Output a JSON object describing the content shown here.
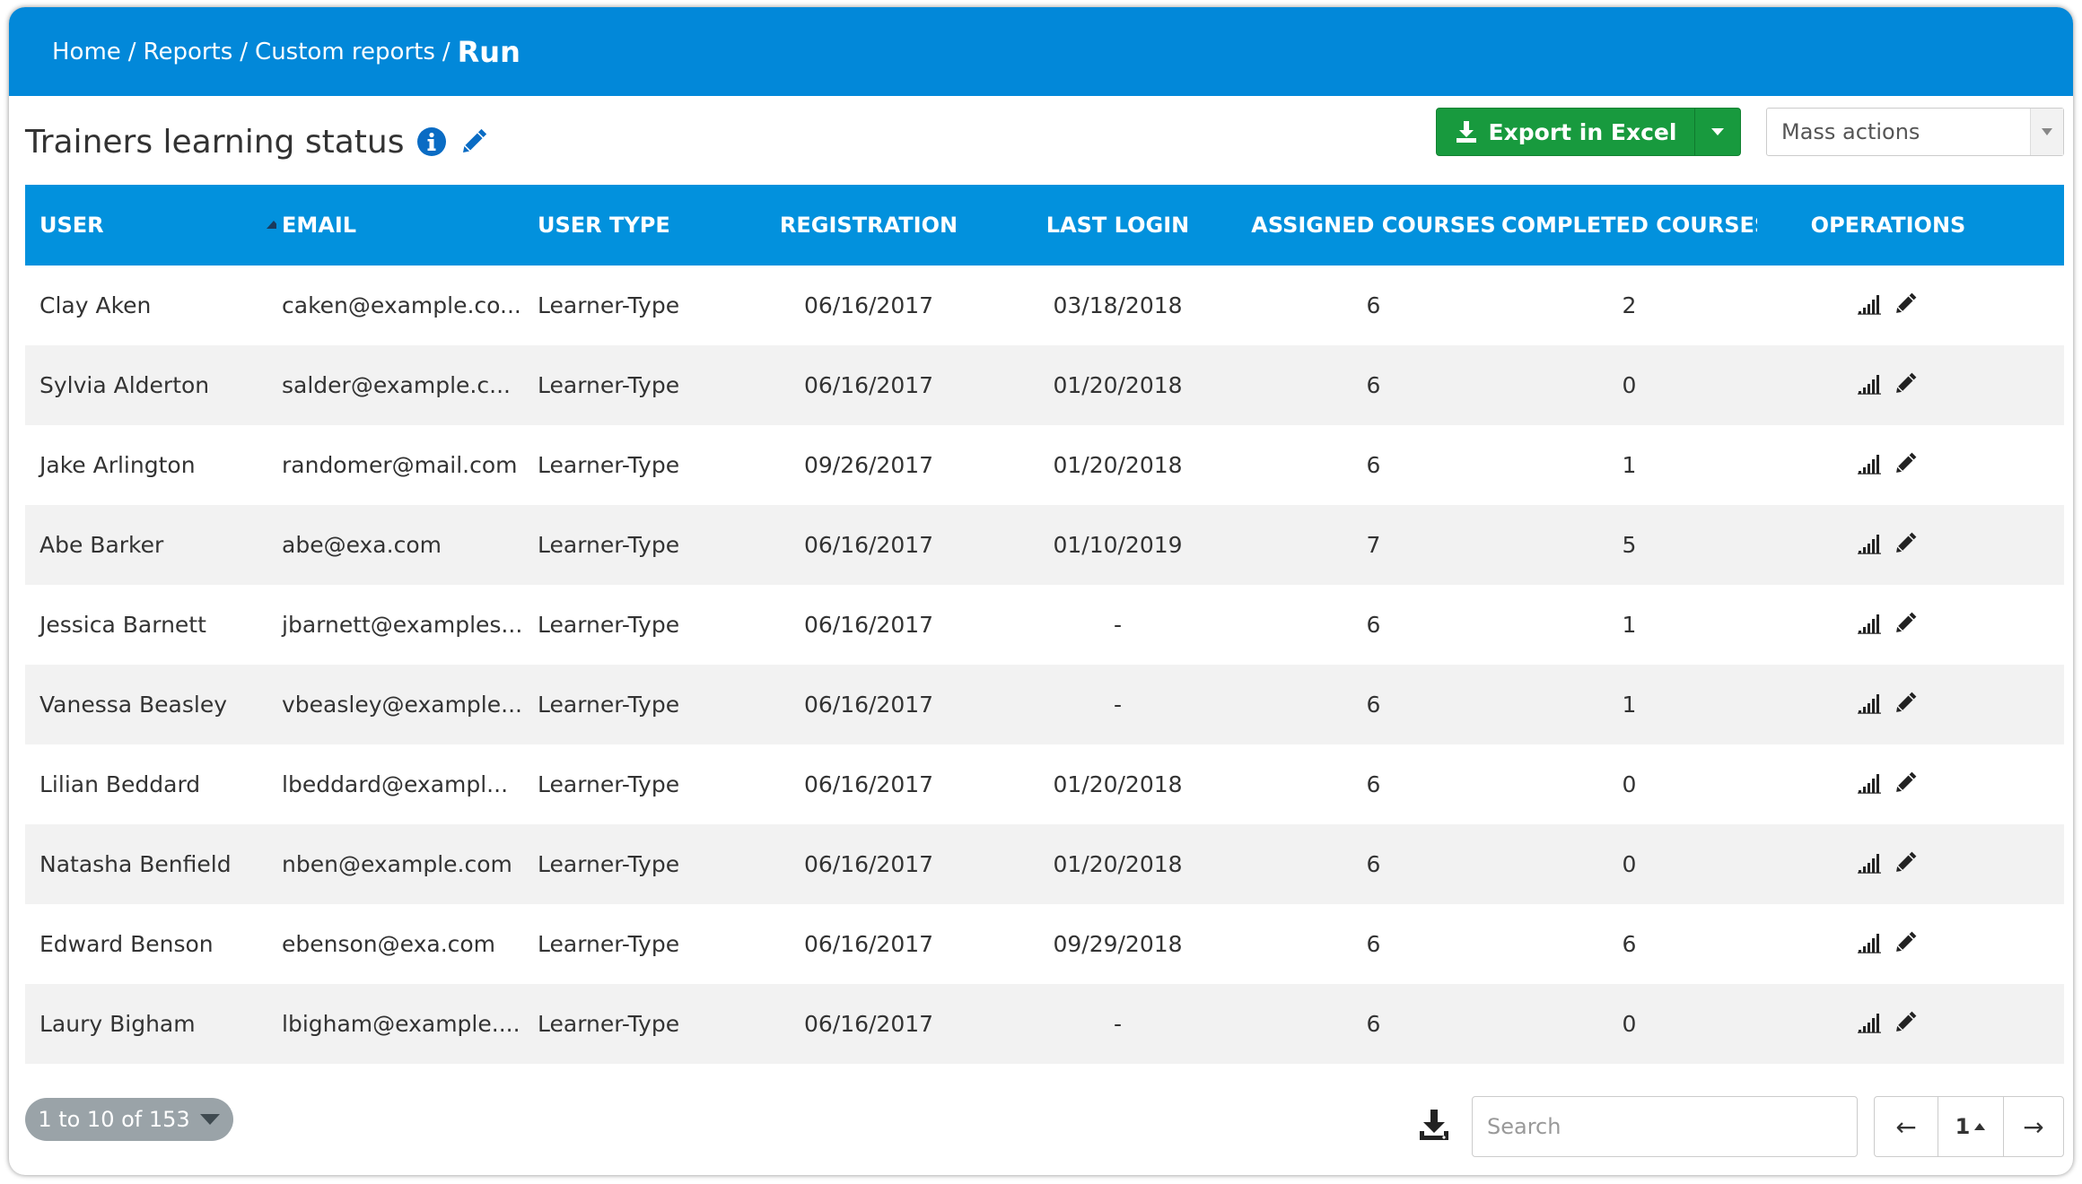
{
  "breadcrumb": {
    "items": [
      "Home",
      "Reports",
      "Custom reports"
    ],
    "current": "Run",
    "separator": "/"
  },
  "report": {
    "title": "Trainers learning status"
  },
  "toolbar": {
    "export_label": "Export in Excel",
    "mass_actions_label": "Mass actions"
  },
  "table": {
    "columns": [
      "USER",
      "EMAIL",
      "USER TYPE",
      "REGISTRATION",
      "LAST LOGIN",
      "ASSIGNED COURSES",
      "COMPLETED COURSES",
      "OPERATIONS"
    ],
    "sorted_column": "USER",
    "sort_direction": "ascending",
    "rows": [
      {
        "user": "Clay Aken",
        "email": "caken@example.co...",
        "type": "Learner-Type",
        "registration": "06/16/2017",
        "last_login": "03/18/2018",
        "assigned": "6",
        "completed": "2"
      },
      {
        "user": "Sylvia Alderton",
        "email": "salder@example.c...",
        "type": "Learner-Type",
        "registration": "06/16/2017",
        "last_login": "01/20/2018",
        "assigned": "6",
        "completed": "0"
      },
      {
        "user": "Jake Arlington",
        "email": "randomer@mail.com",
        "type": "Learner-Type",
        "registration": "09/26/2017",
        "last_login": "01/20/2018",
        "assigned": "6",
        "completed": "1"
      },
      {
        "user": "Abe Barker",
        "email": "abe@exa.com",
        "type": "Learner-Type",
        "registration": "06/16/2017",
        "last_login": "01/10/2019",
        "assigned": "7",
        "completed": "5"
      },
      {
        "user": "Jessica Barnett",
        "email": "jbarnett@examples...",
        "type": "Learner-Type",
        "registration": "06/16/2017",
        "last_login": "-",
        "assigned": "6",
        "completed": "1"
      },
      {
        "user": "Vanessa Beasley",
        "email": "vbeasley@example...",
        "type": "Learner-Type",
        "registration": "06/16/2017",
        "last_login": "-",
        "assigned": "6",
        "completed": "1"
      },
      {
        "user": "Lilian Beddard",
        "email": "lbeddard@exampl...",
        "type": "Learner-Type",
        "registration": "06/16/2017",
        "last_login": "01/20/2018",
        "assigned": "6",
        "completed": "0"
      },
      {
        "user": "Natasha Benfield",
        "email": "nben@example.com",
        "type": "Learner-Type",
        "registration": "06/16/2017",
        "last_login": "01/20/2018",
        "assigned": "6",
        "completed": "0"
      },
      {
        "user": "Edward Benson",
        "email": "ebenson@exa.com",
        "type": "Learner-Type",
        "registration": "06/16/2017",
        "last_login": "09/29/2018",
        "assigned": "6",
        "completed": "6"
      },
      {
        "user": "Laury Bigham",
        "email": "lbigham@example....",
        "type": "Learner-Type",
        "registration": "06/16/2017",
        "last_login": "-",
        "assigned": "6",
        "completed": "0"
      }
    ],
    "row_operations_icons": [
      "signal-bars-icon",
      "pencil-icon"
    ]
  },
  "footer": {
    "range_label": "1 to 10 of 153",
    "search_placeholder": "Search",
    "current_page": "1",
    "prev_symbol": "←",
    "next_symbol": "→"
  },
  "colors": {
    "topbar": "#0288d9",
    "header": "#0291dd",
    "export_button": "#189a3e",
    "stripe": "#f2f2f2",
    "page_range_pill": "#9aa3a8"
  }
}
